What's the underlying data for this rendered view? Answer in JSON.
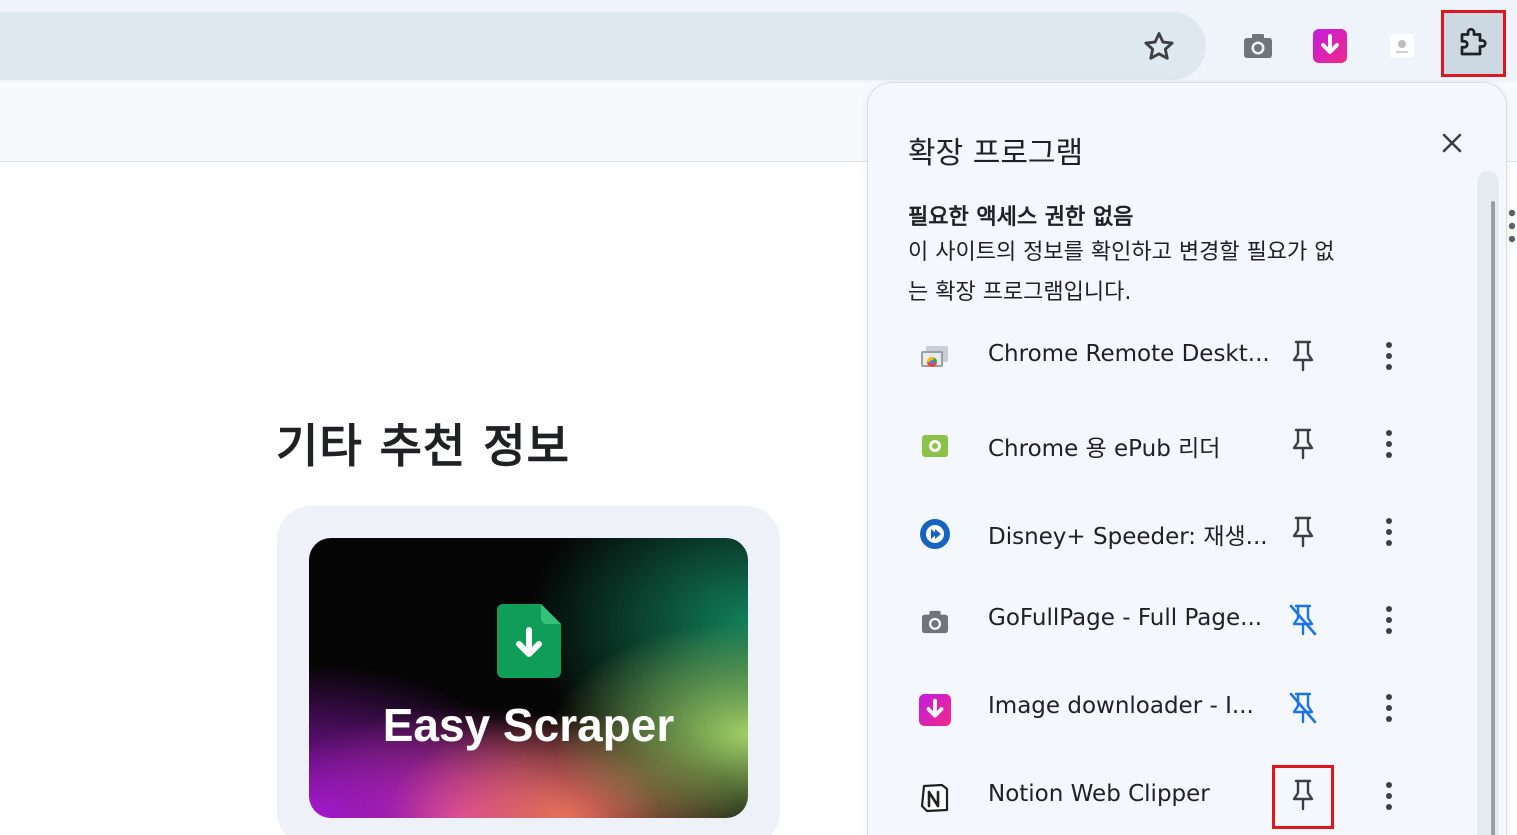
{
  "browser": {
    "toolbar_icons": [
      "star-icon",
      "camera-icon",
      "download-arrow-icon",
      "small-extension-icon",
      "puzzle-piece-icon"
    ]
  },
  "page": {
    "section_title": "기타 추천 정보",
    "card_title": "Easy Scraper"
  },
  "popup": {
    "title": "확장 프로그램",
    "section_heading": "필요한 액세스 권한 없음",
    "section_description_line1": "이 사이트의 정보를 확인하고 변경할 필요가 없",
    "section_description_line2": "는 확장 프로그램입니다.",
    "extensions": [
      {
        "name": "Chrome Remote Deskt...",
        "icon": "chrome-remote-desktop-icon",
        "pinned": false
      },
      {
        "name": "Chrome 용 ePub 리더",
        "icon": "epub-reader-icon",
        "pinned": false
      },
      {
        "name": "Disney+ Speeder: 재생...",
        "icon": "disney-speeder-icon",
        "pinned": false
      },
      {
        "name": "GoFullPage - Full Page...",
        "icon": "camera-icon",
        "pinned": true
      },
      {
        "name": "Image downloader - I...",
        "icon": "image-downloader-icon",
        "pinned": true
      },
      {
        "name": "Notion Web Clipper",
        "icon": "notion-icon",
        "pinned": false
      }
    ]
  },
  "colors": {
    "highlight": "#e0161e",
    "pinned_blue": "#1a73e8",
    "text": "#202124"
  }
}
